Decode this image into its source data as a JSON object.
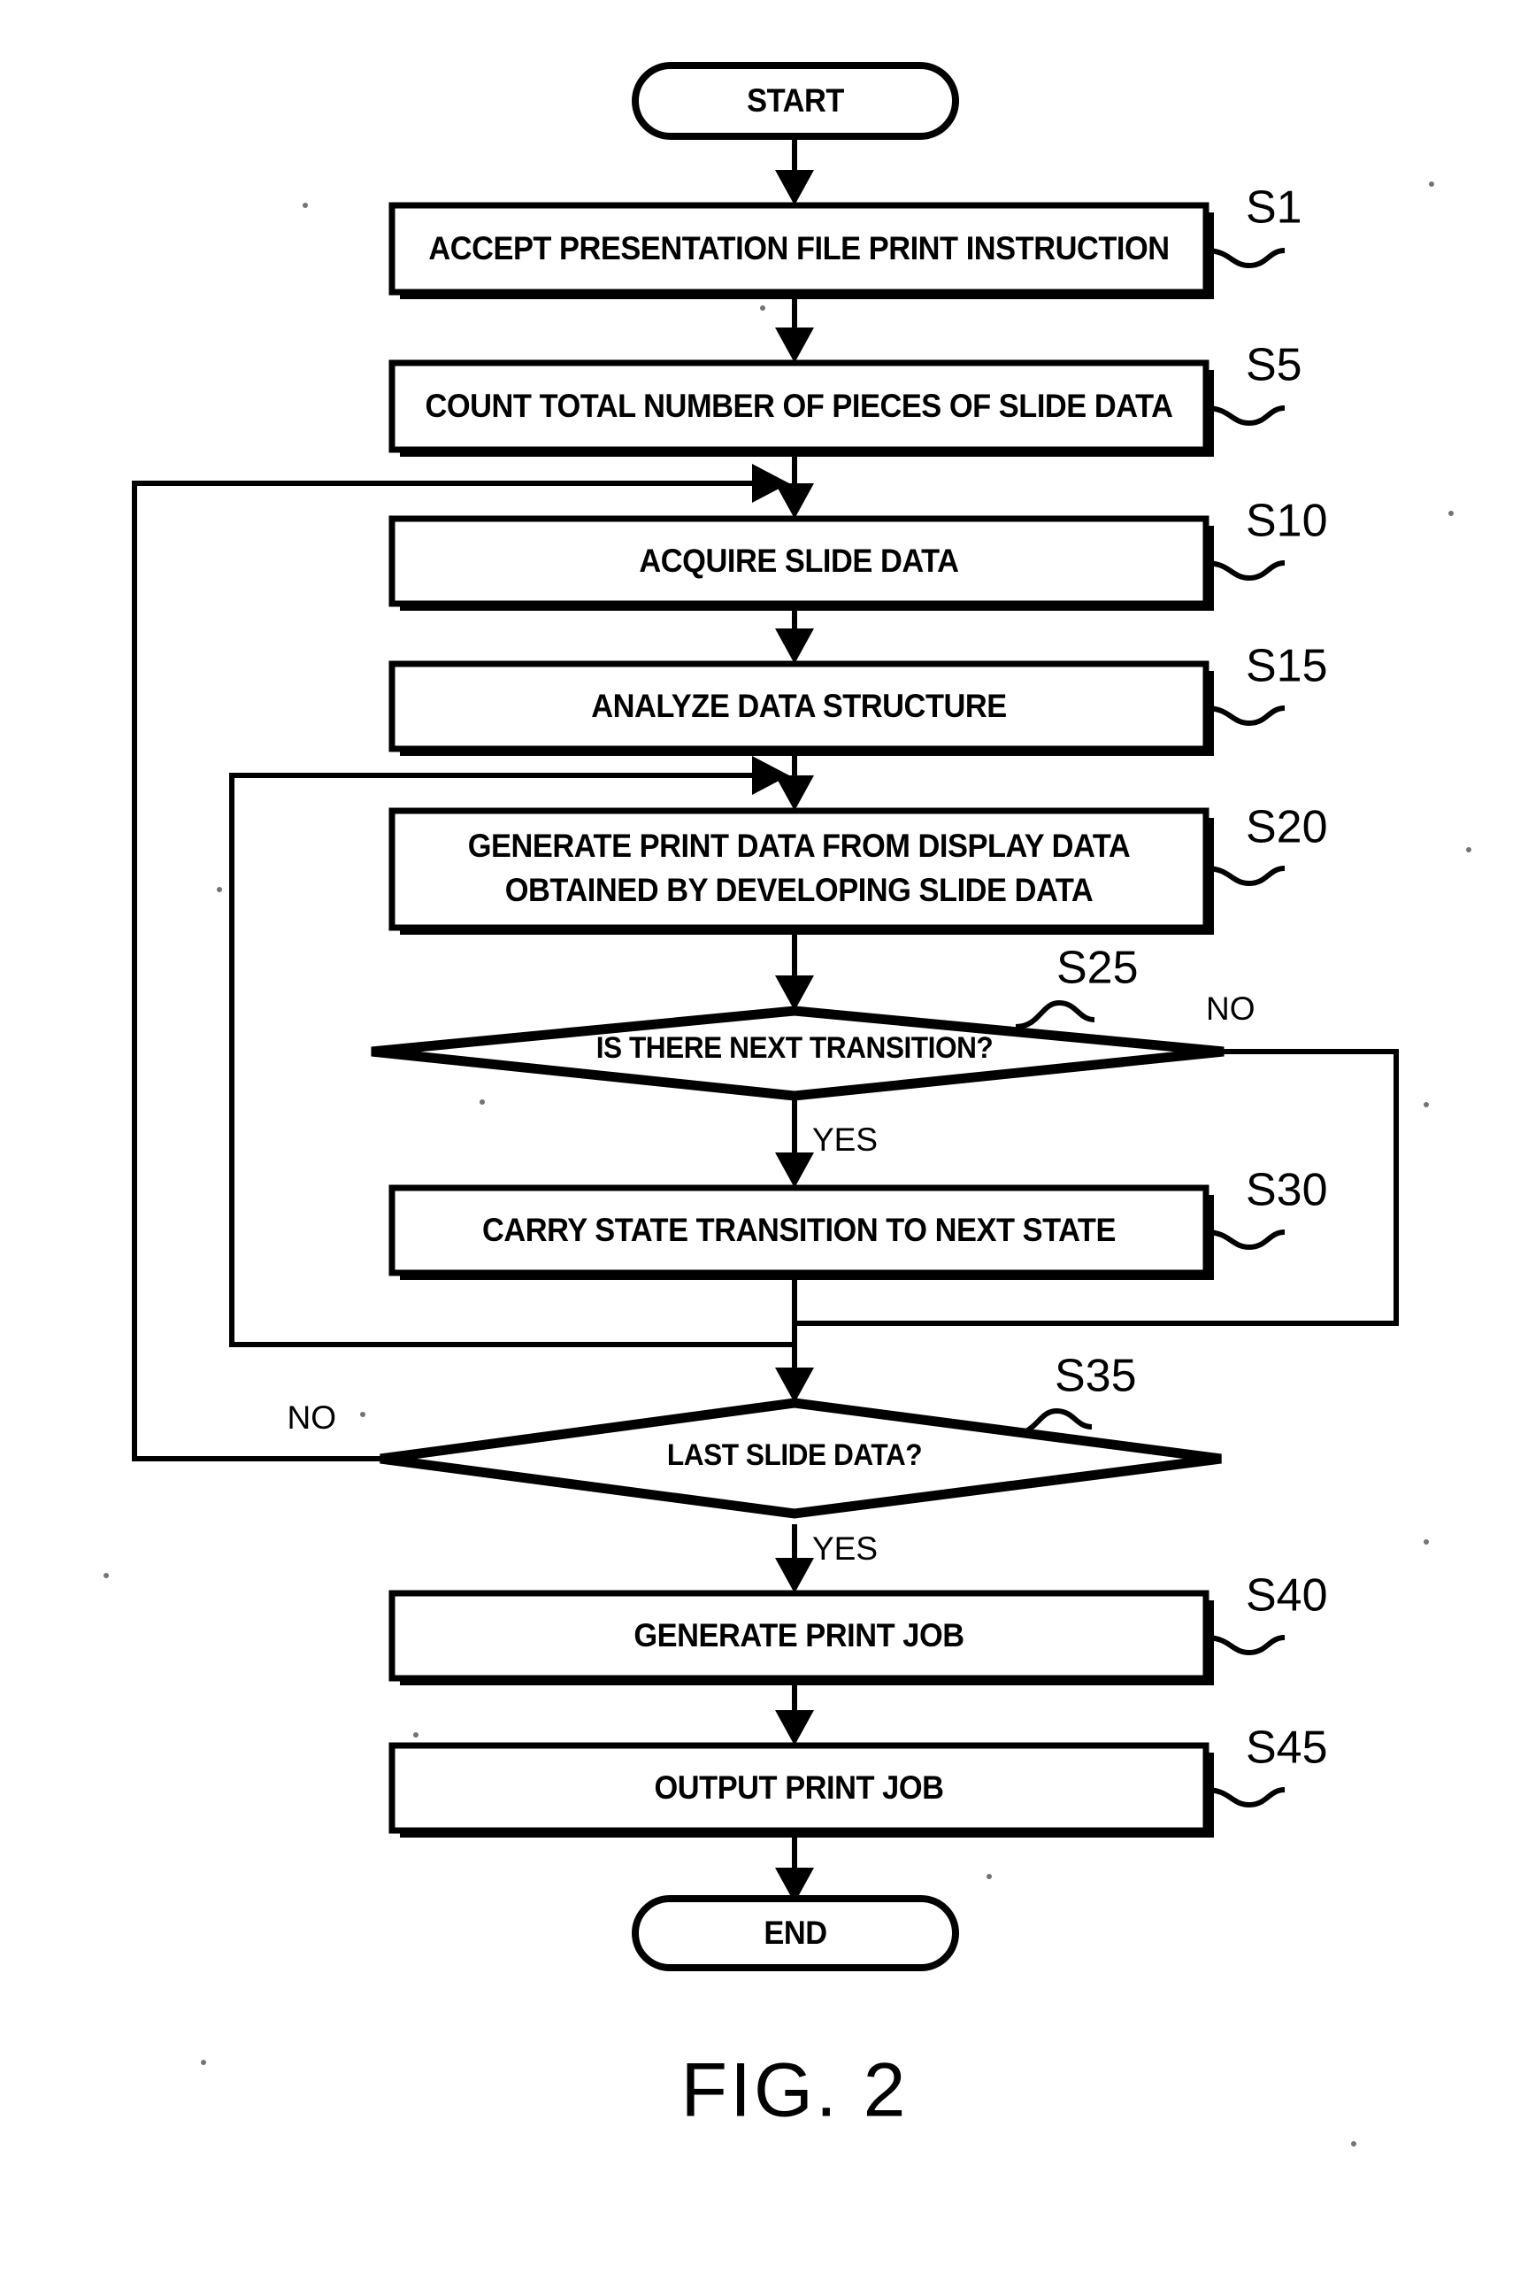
{
  "figure": {
    "caption": "FIG. 2",
    "type": "patent-flowchart"
  },
  "terminals": {
    "start": "START",
    "end": "END"
  },
  "steps": [
    {
      "id": "S1",
      "label": "S1",
      "text_lines": [
        "ACCEPT PRESENTATION FILE PRINT INSTRUCTION"
      ],
      "shape": "process"
    },
    {
      "id": "S5",
      "label": "S5",
      "text_lines": [
        "COUNT TOTAL NUMBER OF PIECES OF SLIDE DATA"
      ],
      "shape": "process"
    },
    {
      "id": "S10",
      "label": "S10",
      "text_lines": [
        "ACQUIRE SLIDE DATA"
      ],
      "shape": "process"
    },
    {
      "id": "S15",
      "label": "S15",
      "text_lines": [
        "ANALYZE DATA STRUCTURE"
      ],
      "shape": "process"
    },
    {
      "id": "S20",
      "label": "S20",
      "text_lines": [
        "GENERATE PRINT DATA FROM DISPLAY DATA",
        "OBTAINED BY DEVELOPING SLIDE DATA"
      ],
      "shape": "process"
    },
    {
      "id": "S25",
      "label": "S25",
      "text_lines": [
        "IS THERE NEXT TRANSITION?"
      ],
      "shape": "decision"
    },
    {
      "id": "S30",
      "label": "S30",
      "text_lines": [
        "CARRY STATE TRANSITION TO NEXT STATE"
      ],
      "shape": "process"
    },
    {
      "id": "S35",
      "label": "S35",
      "text_lines": [
        "LAST SLIDE DATA?"
      ],
      "shape": "decision"
    },
    {
      "id": "S40",
      "label": "S40",
      "text_lines": [
        "GENERATE PRINT JOB"
      ],
      "shape": "process"
    },
    {
      "id": "S45",
      "label": "S45",
      "text_lines": [
        "OUTPUT PRINT JOB"
      ],
      "shape": "process"
    }
  ],
  "branch_labels": {
    "s25_no": "NO",
    "s25_yes": "YES",
    "s35_no": "NO",
    "s35_yes": "YES"
  },
  "colors": {
    "ink": "#000000",
    "paper": "#ffffff"
  }
}
